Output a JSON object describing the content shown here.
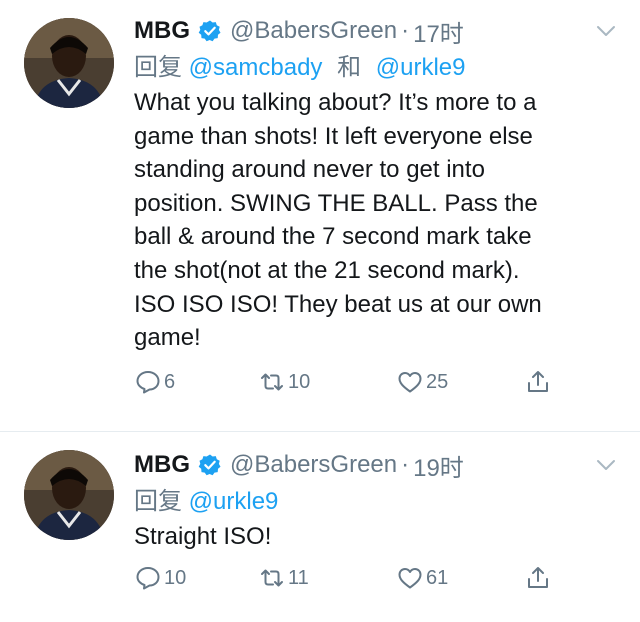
{
  "tweets": [
    {
      "name": "MBG",
      "handle": "@BabersGreen",
      "dot": "·",
      "time": "17时",
      "reply_prefix": "回复",
      "mentions": [
        "@samcbady",
        "@urkle9"
      ],
      "mention_conjunction": "和",
      "text_lines": [
        "What you talking about? It’s more to a",
        "game than shots! It left everyone else",
        "standing around never to get into",
        "position. SWING THE BALL. Pass the",
        "ball & around the 7 second mark take",
        "the shot(not at the 21 second mark).",
        "ISO ISO ISO! They beat us at our own",
        "game!"
      ],
      "replies": "6",
      "retweets": "10",
      "likes": "25"
    },
    {
      "name": "MBG",
      "handle": "@BabersGreen",
      "dot": "·",
      "time": "19时",
      "reply_prefix": "回复",
      "mentions": [
        "@urkle9"
      ],
      "text_lines": [
        "Straight ISO!"
      ],
      "replies": "10",
      "retweets": "11",
      "likes": "61"
    }
  ],
  "colors": {
    "text": "#14171a",
    "secondary": "#657786",
    "mention": "#1da1f2",
    "verified": "#1da1f2",
    "divider": "#e6ecf0"
  },
  "icons": {
    "verified": "verified-badge-icon",
    "menu": "chevron-down-icon",
    "reply": "reply-bubble-icon",
    "retweet": "retweet-icon",
    "like": "heart-icon",
    "share": "share-icon"
  }
}
